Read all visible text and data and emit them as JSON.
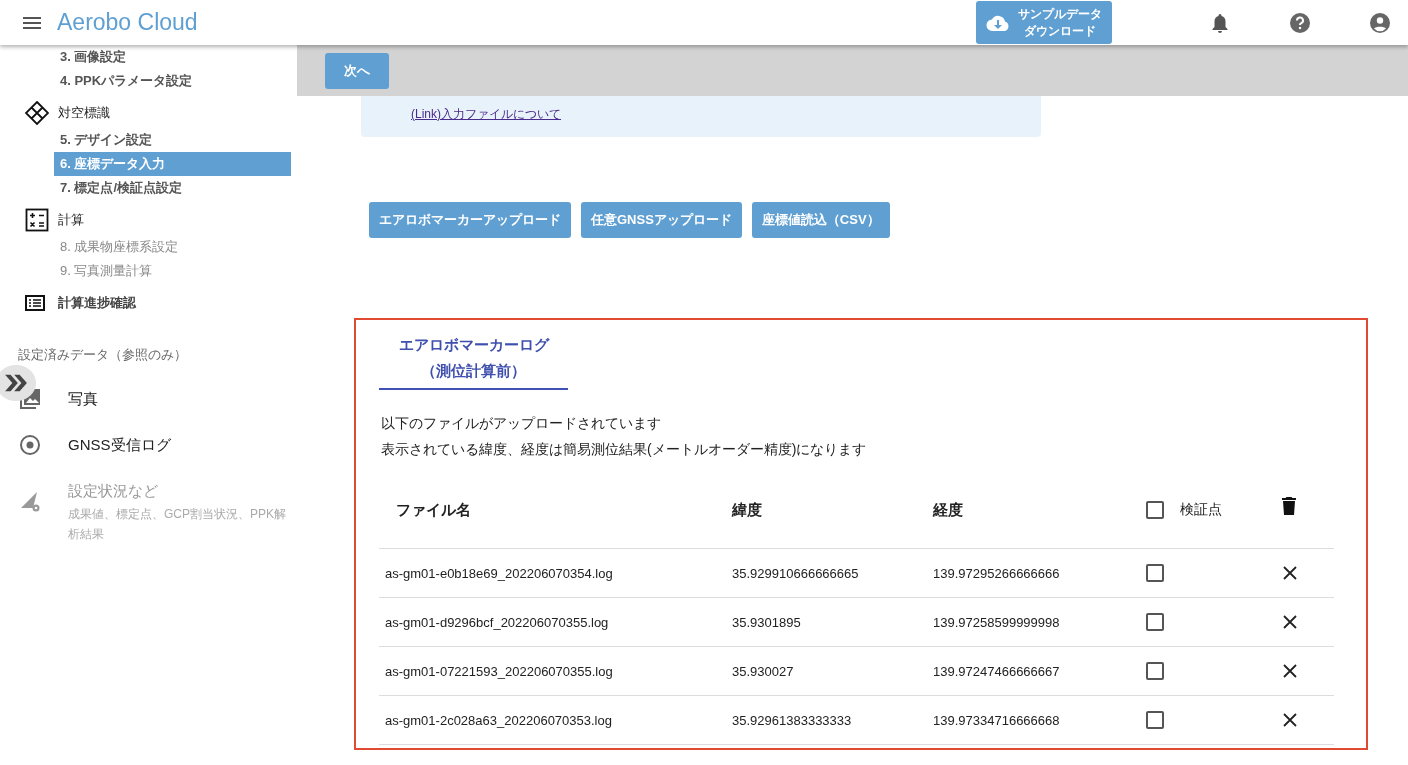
{
  "header": {
    "title": "Aerobo Cloud",
    "sample_button": {
      "line_1": "サンプルデータ",
      "line_2": "ダウンロード"
    }
  },
  "sidebar": {
    "groups": [
      {
        "steps": [
          {
            "label": "3. 画像設定",
            "selected": false,
            "disabled": false
          },
          {
            "label": "4. PPKパラメータ設定",
            "selected": false,
            "disabled": false
          }
        ]
      },
      {
        "title": "対空標識",
        "kind": "diamond",
        "steps": [
          {
            "label": "5. デザイン設定",
            "selected": false,
            "disabled": false
          },
          {
            "label": "6. 座標データ入力",
            "selected": true,
            "disabled": false
          },
          {
            "label": "7. 標定点/検証点設定",
            "selected": false,
            "disabled": false
          }
        ]
      },
      {
        "title": "計算",
        "kind": "calculator",
        "steps": [
          {
            "label": "8. 成果物座標系設定",
            "selected": false,
            "disabled": true
          },
          {
            "label": "9. 写真測量計算",
            "selected": false,
            "disabled": true
          }
        ]
      },
      {
        "title": "計算進捗確認",
        "kind": "list"
      }
    ],
    "data_heading": "設定済みデータ（参照のみ）",
    "data_items": [
      {
        "label": "写真",
        "kind": "photo",
        "disabled": false
      },
      {
        "label": "GNSS受信ログ",
        "kind": "radio",
        "disabled": false
      },
      {
        "label": "設定状況など",
        "sub_label": "成果値、標定点、GCP割当状況、PPK解析結果",
        "kind": "signal",
        "disabled": true
      }
    ]
  },
  "main": {
    "next_button": "次へ",
    "info_link": "(Link)入力ファイルについて",
    "upload_buttons": [
      "エアロボマーカーアップロード",
      "任意GNSSアップロード",
      "座標値読込（CSV）"
    ],
    "log_panel": {
      "tabs": [
        {
          "label": "エアロボマーカーログ",
          "sub_label": "（測位計算前）",
          "selected": true
        }
      ],
      "notes": [
        "以下のファイルがアップロードされています",
        "表示されている緯度、経度は簡易測位結果(メートルオーダー精度)になります"
      ],
      "columns": [
        "ファイル名",
        "緯度",
        "経度",
        "検証点"
      ],
      "check_all": false,
      "rows": [
        {
          "file": "as-gm01-e0b18e69_202206070354.log",
          "lat": "35.929910666666665",
          "lon": "139.97295266666666",
          "checked": false
        },
        {
          "file": "as-gm01-d9296bcf_202206070355.log",
          "lat": "35.9301895",
          "lon": "139.97258599999998",
          "checked": false
        },
        {
          "file": "as-gm01-07221593_202206070355.log",
          "lat": "35.930027",
          "lon": "139.97247466666667",
          "checked": false
        },
        {
          "file": "as-gm01-2c028a63_202206070353.log",
          "lat": "35.92961383333333",
          "lon": "139.97334716666668",
          "checked": false
        }
      ]
    }
  }
}
